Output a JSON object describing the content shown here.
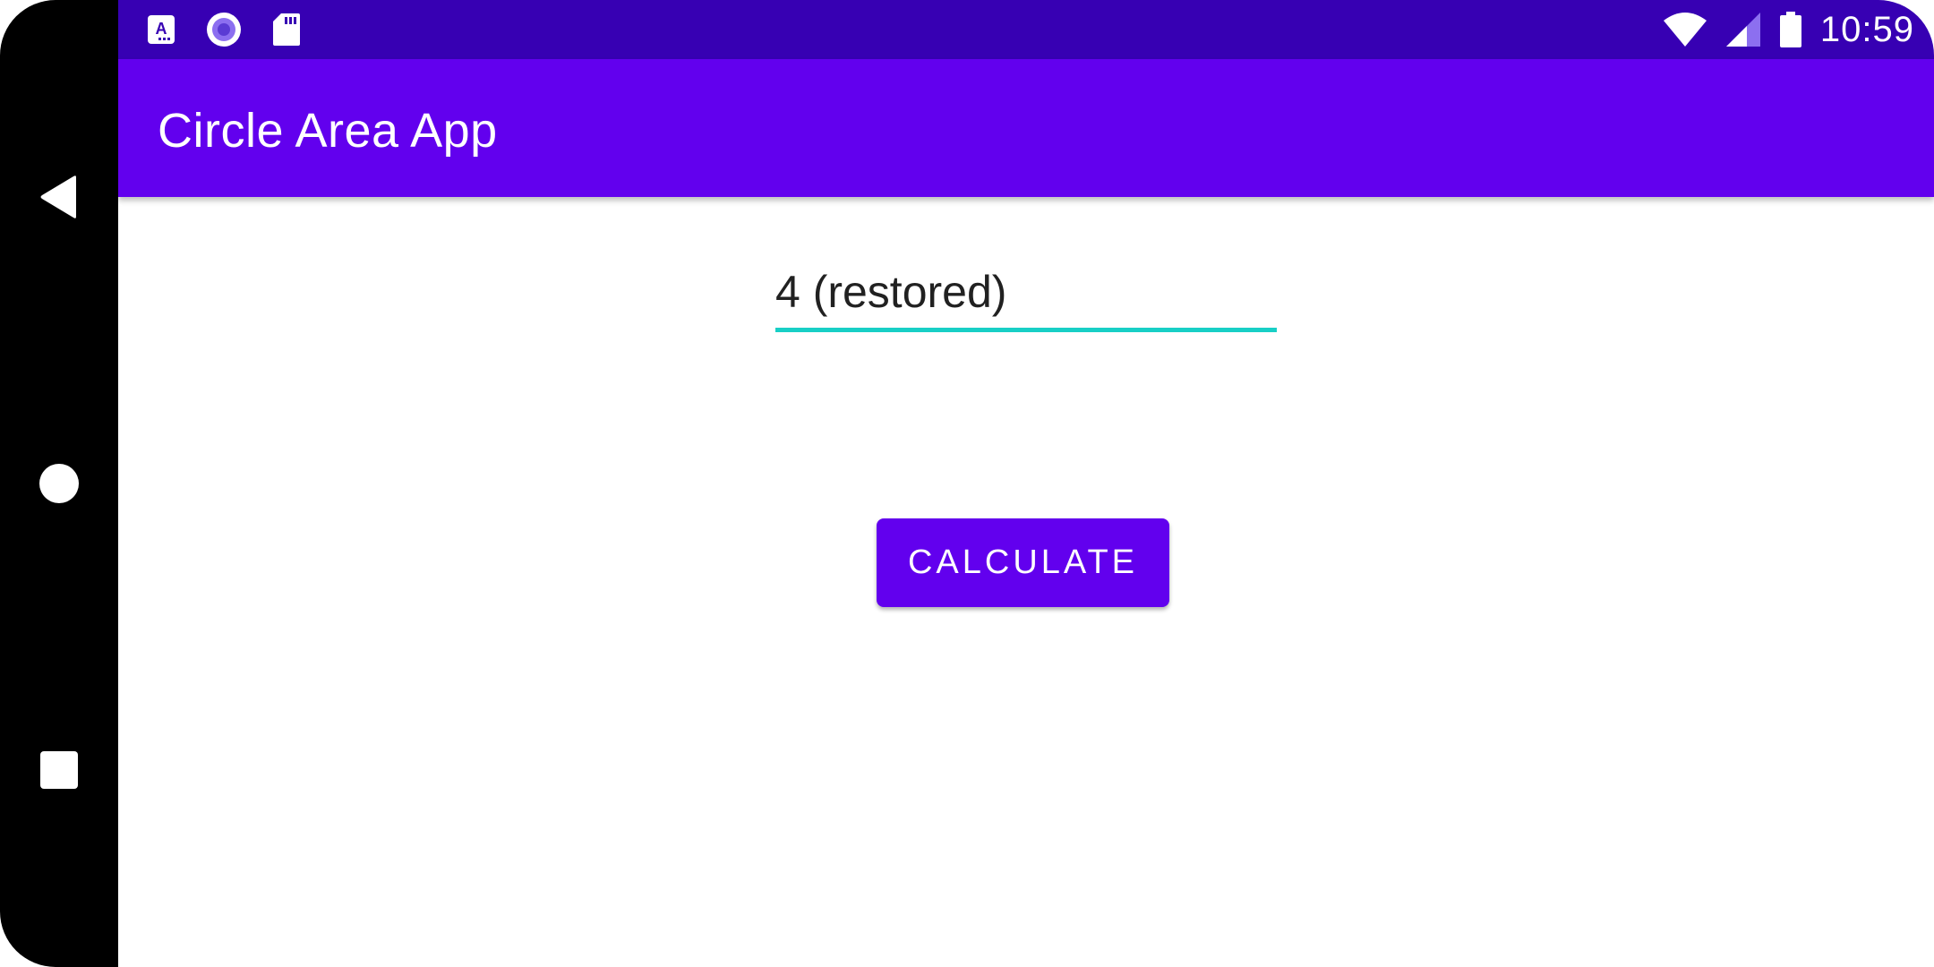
{
  "status_bar": {
    "time": "10:59",
    "left_icons": [
      "app-notification-icon",
      "record-icon",
      "sd-card-icon"
    ],
    "right_icons": [
      "wifi-icon",
      "signal-icon",
      "battery-icon"
    ],
    "background_color": "#3700b3"
  },
  "app_bar": {
    "title": "Circle Area App",
    "background_color": "#6200ee"
  },
  "radius_field": {
    "value": "4 (restored)",
    "underline_color": "#18cfc6"
  },
  "calculate_button": {
    "label": "CALCULATE",
    "background_color": "#6200ee"
  },
  "navigation_bar": {
    "buttons": [
      "back-icon",
      "home-icon",
      "recents-icon"
    ]
  }
}
